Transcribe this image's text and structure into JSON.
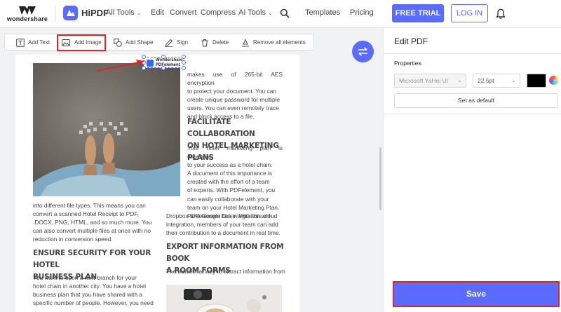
{
  "brand": {
    "name": "wondershare",
    "product": "HiPDF"
  },
  "nav": {
    "all_tools": "All Tools",
    "edit": "Edit",
    "convert": "Convert",
    "compress": "Compress",
    "ai_tools": "AI Tools",
    "templates": "Templates",
    "pricing": "Pricing",
    "free_trial": "FREE TRIAL",
    "login": "LOG IN"
  },
  "toolbar": {
    "add_text": "Add Text",
    "add_image": "Add Image",
    "add_shape": "Add Shape",
    "sign": "Sign",
    "delete": "Delete",
    "remove_all": "Remove all elements"
  },
  "placed_element": {
    "line1": "Wondershare",
    "line2": "PDFelement"
  },
  "document": {
    "right_intro": [
      "makes use of 265-bit AES encryption",
      "to protect your document. You can",
      "create unique password for multiple",
      "users. You can even remotely trace",
      "and block access to a file."
    ],
    "heading_facilitate": [
      "FACILITATE  COLLABORATION",
      "ON HOTEL MARKETING PLANS"
    ],
    "facilitate_body": [
      "Your hotel marketing plan is essential",
      "to your success as a hotel chain.",
      "A document of this importance is",
      "created with the effort of a team",
      "of experts. With PDFelement, you",
      "can easily collaborate with your",
      "team on your Hotel Marketing Plan.",
      "PDFelement has integration with"
    ],
    "facilitate_wide": [
      "Dropbox and Google Drive. With this cloud",
      "integration, members of your team can add",
      "their contribution to a document in real time."
    ],
    "left_convert": [
      "into different file types. This means you can",
      "convert a scanned Hotel Receipt to PDF,",
      ".DOCX, PNG, HTML, and so much more. You",
      "can also convert multiple files at once with no",
      "reduction in conversion speed."
    ],
    "heading_security": [
      "ENSURE SECURITY FOR YOUR HOTEL",
      "BUSINESS PLAN"
    ],
    "security_body": [
      "You want to open a new branch for your",
      "hotel chain in another city. You have a hotel",
      "business plan that you have shared with a",
      "specific number of people. However, you need"
    ],
    "heading_export": [
      "EXPORT INFORMATION FROM BOOK",
      "A ROOM FORMS"
    ],
    "export_body": "The traditional way to extract information from"
  },
  "panel": {
    "title": "Edit PDF",
    "properties_label": "Properties",
    "font": "Microsoft YaHei UI",
    "size": "22.5pt",
    "color": "#000000",
    "set_default": "Set as default",
    "save": "Save"
  },
  "colors": {
    "accent": "#5a6bff",
    "highlight": "#e02626"
  },
  "icons": [
    "search-icon",
    "bell-icon",
    "swap-icon",
    "text-icon",
    "image-icon",
    "shape-icon",
    "sign-icon",
    "trash-icon",
    "eraser-icon"
  ]
}
